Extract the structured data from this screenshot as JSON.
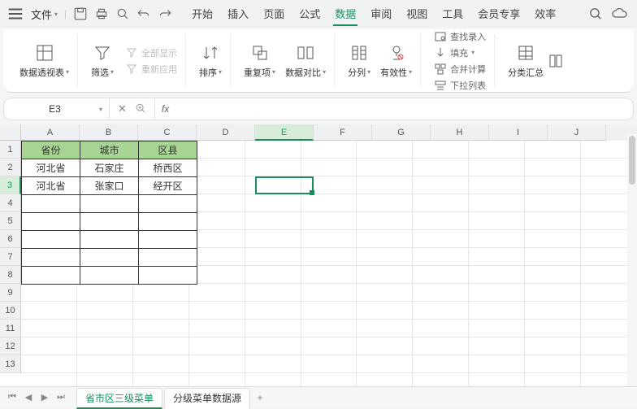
{
  "menu": {
    "file_label": "文件"
  },
  "tabs": [
    "开始",
    "插入",
    "页面",
    "公式",
    "数据",
    "审阅",
    "视图",
    "工具",
    "会员专享",
    "效率"
  ],
  "active_tab": 4,
  "ribbon": {
    "pivot": "数据透视表",
    "filter": "筛选",
    "show_all": "全部显示",
    "reapply": "重新应用",
    "sort": "排序",
    "dup": "重复项",
    "compare": "数据对比",
    "split": "分列",
    "valid": "有效性",
    "lookup": "查找录入",
    "consolidate": "合并计算",
    "fill": "填充",
    "dropdown": "下拉列表",
    "subtotal": "分类汇总"
  },
  "name_box": "E3",
  "cols": [
    "A",
    "B",
    "C",
    "D",
    "E",
    "F",
    "G",
    "H",
    "I",
    "J"
  ],
  "sel_col_idx": 4,
  "rows": [
    "1",
    "2",
    "3",
    "4",
    "5",
    "6",
    "7",
    "8",
    "9",
    "10",
    "11",
    "12",
    "13"
  ],
  "sel_row_idx": 2,
  "table": {
    "headers": [
      "省份",
      "城市",
      "区县"
    ],
    "rows": [
      [
        "河北省",
        "石家庄",
        "桥西区"
      ],
      [
        "河北省",
        "张家口",
        "经开区"
      ],
      [
        "",
        "",
        ""
      ],
      [
        "",
        "",
        ""
      ],
      [
        "",
        "",
        ""
      ],
      [
        "",
        "",
        ""
      ],
      [
        "",
        "",
        ""
      ]
    ]
  },
  "sheets": [
    "省市区三级菜单",
    "分级菜单数据源"
  ],
  "active_sheet": 0
}
